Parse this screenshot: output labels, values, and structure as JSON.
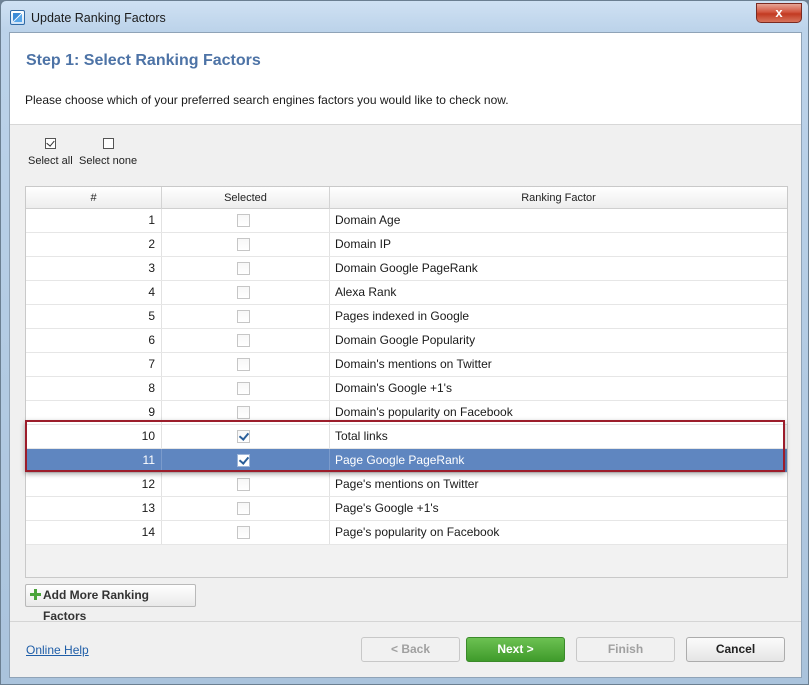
{
  "window": {
    "title": "Update Ranking Factors",
    "close_glyph": "x"
  },
  "header": {
    "step_title": "Step 1: Select Ranking Factors",
    "description": "Please choose which of your preferred search engines factors you would like to check now."
  },
  "toolbar": {
    "select_all": "Select all",
    "select_none": "Select none"
  },
  "table": {
    "columns": [
      "#",
      "Selected",
      "Ranking Factor"
    ],
    "rows": [
      {
        "num": "1",
        "selected": false,
        "factor": "Domain Age"
      },
      {
        "num": "2",
        "selected": false,
        "factor": "Domain IP"
      },
      {
        "num": "3",
        "selected": false,
        "factor": "Domain Google PageRank"
      },
      {
        "num": "4",
        "selected": false,
        "factor": "Alexa Rank"
      },
      {
        "num": "5",
        "selected": false,
        "factor": "Pages indexed in Google"
      },
      {
        "num": "6",
        "selected": false,
        "factor": "Domain Google Popularity"
      },
      {
        "num": "7",
        "selected": false,
        "factor": "Domain's mentions on Twitter"
      },
      {
        "num": "8",
        "selected": false,
        "factor": "Domain's Google +1's"
      },
      {
        "num": "9",
        "selected": false,
        "factor": "Domain's popularity on Facebook"
      },
      {
        "num": "10",
        "selected": true,
        "factor": "Total links"
      },
      {
        "num": "11",
        "selected": true,
        "factor": "Page Google PageRank",
        "highlighted": true
      },
      {
        "num": "12",
        "selected": false,
        "factor": "Page's mentions on Twitter"
      },
      {
        "num": "13",
        "selected": false,
        "factor": "Page's Google +1's"
      },
      {
        "num": "14",
        "selected": false,
        "factor": "Page's popularity on Facebook"
      }
    ]
  },
  "actions": {
    "add_more": "Add More Ranking Factors",
    "online_help": "Online Help",
    "back": "< Back",
    "next": "Next >",
    "finish": "Finish",
    "cancel": "Cancel"
  },
  "colors": {
    "accent_title": "#4d73a6",
    "selection": "#5f86c0",
    "highlight_frame": "#9c1d2b",
    "next_button": "#4fae3a"
  }
}
